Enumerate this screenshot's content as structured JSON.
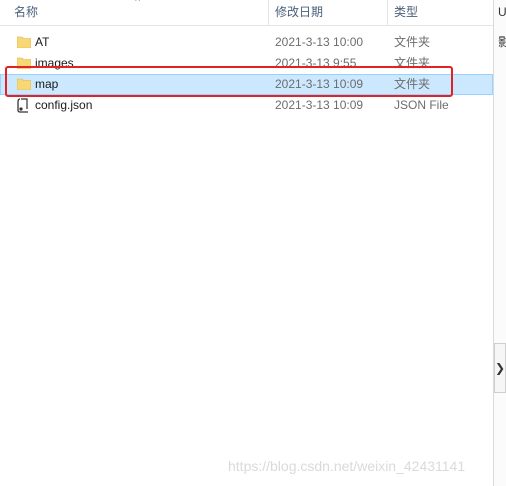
{
  "columns": {
    "name": "名称",
    "date": "修改日期",
    "type": "类型"
  },
  "files": [
    {
      "name": "AT",
      "date": "2021-3-13 10:00",
      "type": "文件夹",
      "icon": "folder-icon",
      "selected": false
    },
    {
      "name": "images",
      "date": "2021-3-13 9:55",
      "type": "文件夹",
      "icon": "folder-icon",
      "selected": false
    },
    {
      "name": "map",
      "date": "2021-3-13 10:09",
      "type": "文件夹",
      "icon": "folder-icon",
      "selected": true
    },
    {
      "name": "config.json",
      "date": "2021-3-13 10:09",
      "type": "JSON File",
      "icon": "json-file-icon",
      "selected": false
    }
  ],
  "side_panel": {
    "top_char": "U",
    "second_char": "影",
    "expand_glyph": "❯"
  },
  "watermark": "https://blog.csdn.net/weixin_42431141",
  "colors": {
    "selection_bg": "#cce8ff",
    "selection_border": "#99d1ff",
    "highlight": "#e02424",
    "folder": "#f8d775"
  }
}
